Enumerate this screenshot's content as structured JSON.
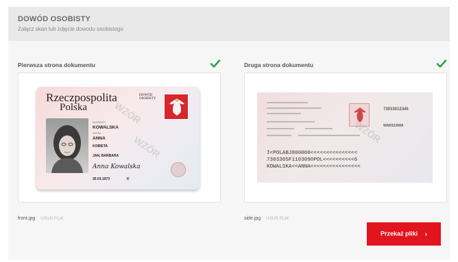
{
  "section": {
    "title": "DOWÓD OSOBISTY",
    "subtitle": "Załącz skan lub zdjęcie dowodu osobistego"
  },
  "uploads": [
    {
      "label": "Pierwsza strona dokumentu",
      "file_name": "front.jpg",
      "remove_label": "USUŃ PLIK",
      "status_icon": "check-icon",
      "preview": {
        "country_line1": "Rzeczpospolita",
        "country_line2": "Polska",
        "doc_type_line1": "DOWÓD",
        "doc_type_line2": "OSOBISTY",
        "surname": "KOWALSKA",
        "given_name": "ANNA",
        "sex": "KOBIETA",
        "parents": "JAN, BARBARA",
        "signature": "Anna Kowalska",
        "birth_date": "30.03.1973",
        "sex_code": "K"
      }
    },
    {
      "label": "Druga strona dokumentu",
      "file_name": "side.jpg",
      "remove_label": "USUŃ PLIK",
      "status_icon": "check-icon",
      "preview": {
        "mrz_line1": "I<POLABJ800000<<<<<<<<<<<<<<<",
        "mrz_line2": "7303305F1103090POL<<<<<<<<<<6",
        "mrz_line3": "KOWALSKA<<ANNA<<<<<<<<<<<<<<<<",
        "card_number": "73033012345",
        "city": "WARSZAWA"
      }
    }
  ],
  "submit": {
    "label": "Przekaż pliki",
    "chevron": "›"
  },
  "colors": {
    "accent": "#e2141d",
    "success": "#2aa34a",
    "header_bg": "#e9e9e9",
    "panel_bg": "#f6f6f6"
  }
}
